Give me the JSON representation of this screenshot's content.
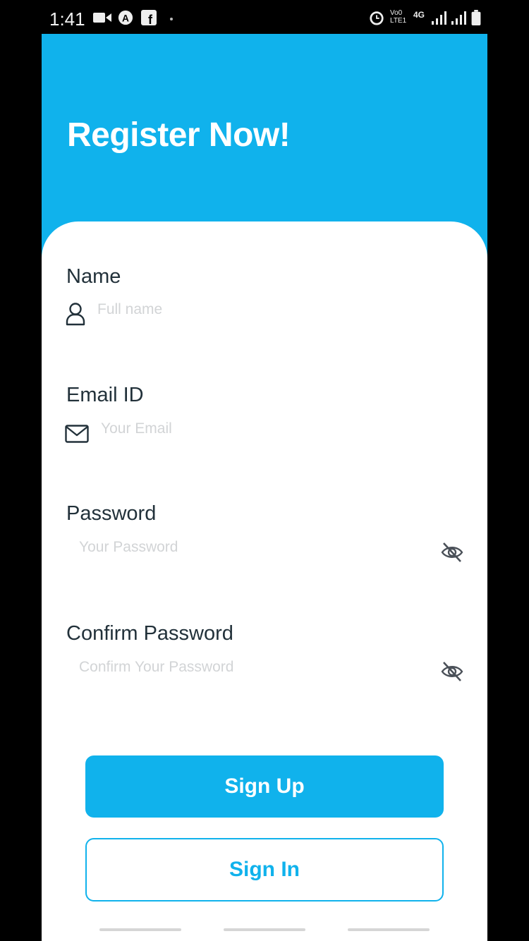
{
  "status_bar": {
    "time": "1:41",
    "icons_left": [
      "video-icon",
      "app-a-icon",
      "facebook-icon",
      "dot-icon"
    ],
    "icons_right": [
      "alarm-icon",
      "volte-icon",
      "4g-icon",
      "signal-icon",
      "signal-icon",
      "battery-icon"
    ],
    "volte_text": "Vo0 LTE1",
    "network_text": "4G"
  },
  "header": {
    "title": "Register Now!"
  },
  "form": {
    "name": {
      "label": "Name",
      "placeholder": "Full name",
      "icon": "user-icon"
    },
    "email": {
      "label": "Email ID",
      "placeholder": "Your Email",
      "icon": "mail-icon"
    },
    "password": {
      "label": "Password",
      "placeholder": "Your Password",
      "toggle_icon": "eye-off-icon"
    },
    "confirm_password": {
      "label": "Confirm Password",
      "placeholder": "Confirm Your Password",
      "toggle_icon": "eye-off-icon"
    }
  },
  "buttons": {
    "sign_up": "Sign Up",
    "sign_in": "Sign In"
  },
  "colors": {
    "primary": "#10b2ec",
    "label_text": "#22313a",
    "placeholder": "#d2d4d6"
  }
}
